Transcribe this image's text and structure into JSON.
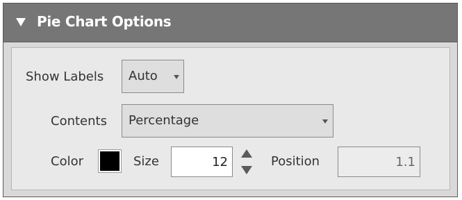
{
  "panel": {
    "title": "Pie Chart Options"
  },
  "show_labels": {
    "label": "Show Labels",
    "value": "Auto"
  },
  "contents": {
    "label": "Contents",
    "value": "Percentage"
  },
  "color": {
    "label": "Color",
    "value": "#000000"
  },
  "size": {
    "label": "Size",
    "value": "12"
  },
  "position": {
    "label": "Position",
    "value": "1.1"
  },
  "icons": {
    "collapse": "collapse-triangle-icon",
    "dropdown": "caret-down-icon",
    "stepper_up": "arrow-up-icon",
    "stepper_down": "arrow-down-icon"
  },
  "colors": {
    "header_bg": "#767676",
    "panel_bg": "#d9d9d9",
    "body_bg": "#e9e9e9",
    "disabled_input_bg": "#ececec"
  }
}
